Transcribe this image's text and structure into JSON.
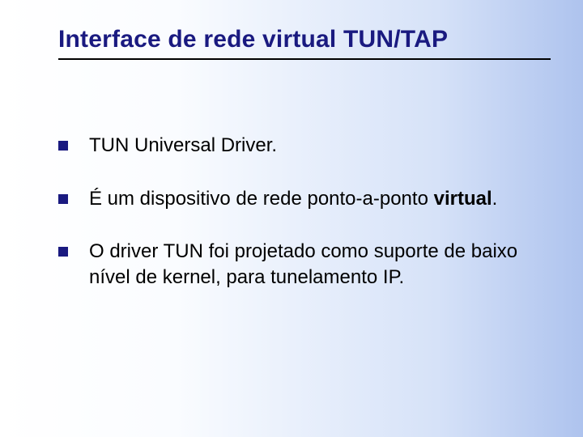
{
  "slide": {
    "title": "Interface de rede virtual TUN/TAP",
    "bullets": [
      {
        "text": "TUN Universal Driver."
      },
      {
        "prefix": "É um dispositivo de rede ponto-a-ponto ",
        "bold": "virtual",
        "suffix": "."
      },
      {
        "text": "O driver TUN foi projetado como suporte de baixo nível de kernel, para tunelamento IP."
      }
    ]
  }
}
